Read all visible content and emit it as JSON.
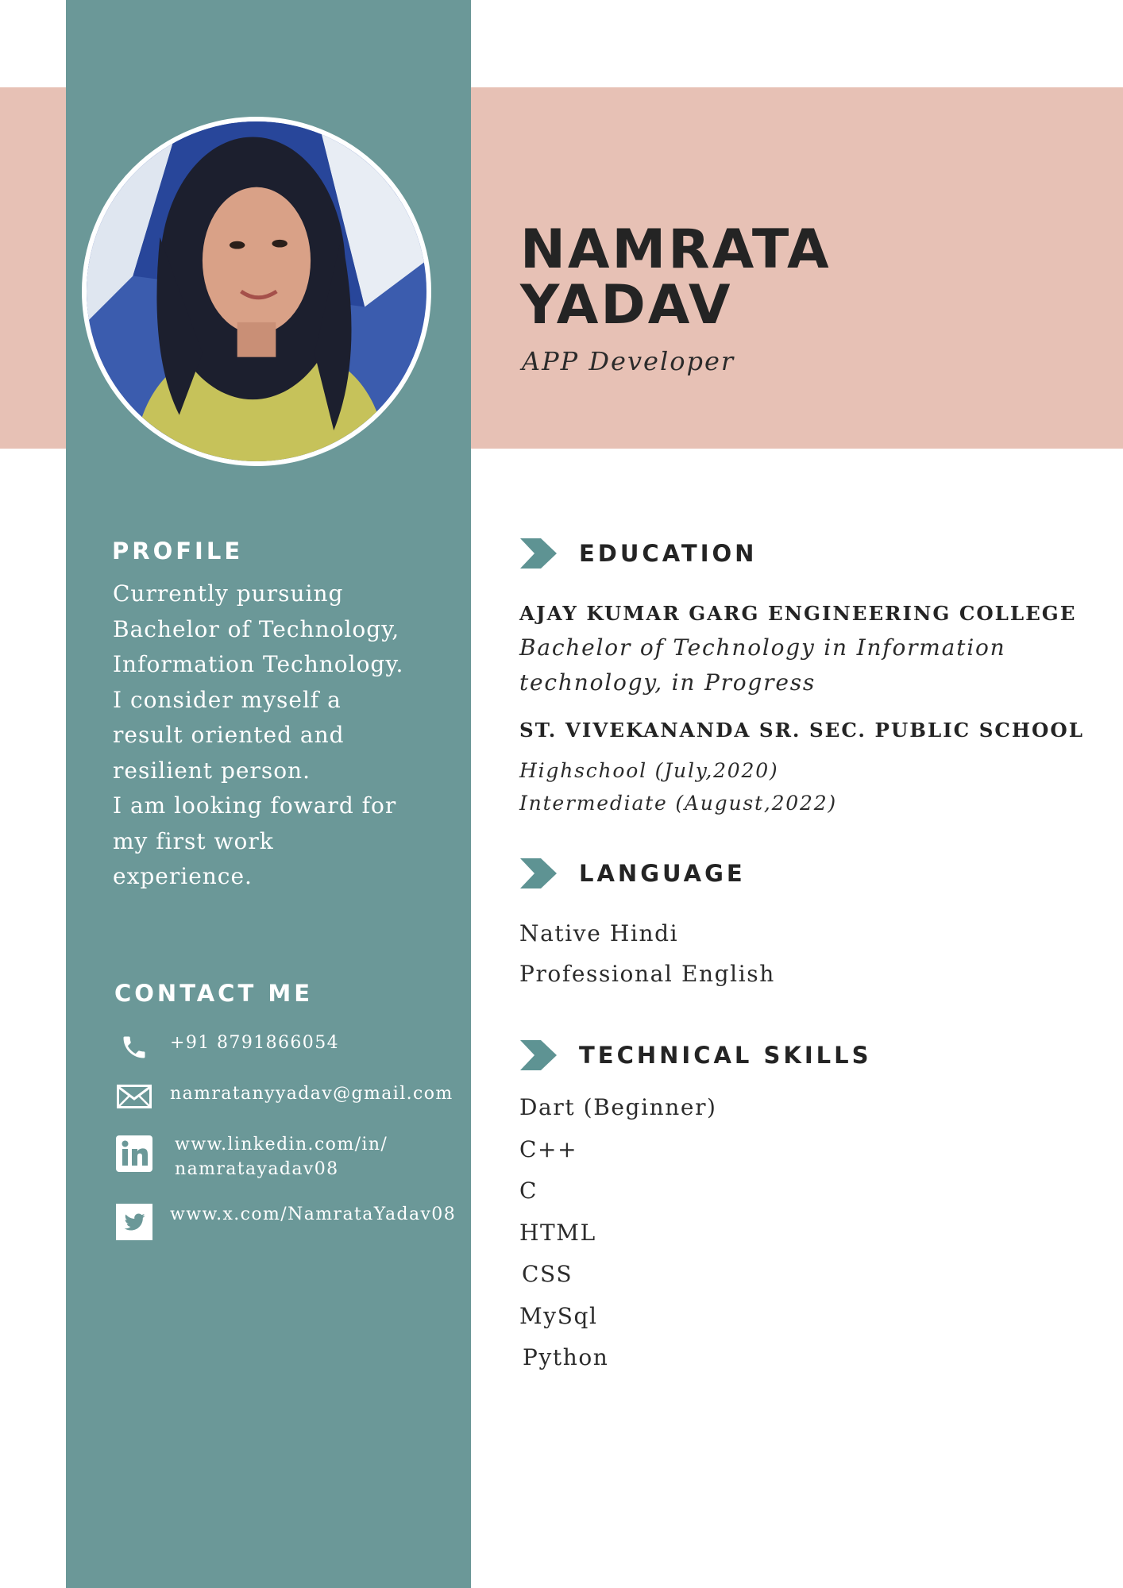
{
  "header": {
    "name_line1": "NAMRATA",
    "name_line2": "YADAV",
    "role": "APP Developer"
  },
  "profile": {
    "heading": "PROFILE",
    "lines": [
      "Currently pursuing",
      "Bachelor of Technology,",
      "Information Technology.",
      "I consider myself a",
      "result oriented and",
      "resilient person.",
      "I am looking foward for",
      "my first work",
      "experience."
    ]
  },
  "contact": {
    "heading": "CONTACT ME",
    "phone": "+91 8791866054",
    "email": "namratanyyadav@gmail.com",
    "linkedin_line1": "www.linkedin.com/in/",
    "linkedin_line2": "namratayadav08",
    "twitter": "www.x.com/NamrataYadav08",
    "icons": [
      "phone-icon",
      "mail-icon",
      "linkedin-icon",
      "twitter-icon"
    ]
  },
  "education": {
    "heading": "EDUCATION",
    "schools": [
      {
        "name": "AJAY KUMAR GARG ENGINEERING COLLEGE",
        "details": [
          "Bachelor of Technology in Information",
          "technology, in Progress"
        ]
      },
      {
        "name": "ST. VIVEKANANDA SR. SEC. PUBLIC SCHOOL",
        "details": [
          "Highschool (July,2020)",
          "Intermediate (August,2022)"
        ]
      }
    ]
  },
  "language": {
    "heading": "LANGUAGE",
    "items": [
      "Native Hindi",
      "Professional English"
    ]
  },
  "skills": {
    "heading": "TECHNICAL SKILLS",
    "items": [
      "Dart (Beginner)",
      "C++",
      "C",
      "HTML",
      "CSS",
      "MySql",
      "Python"
    ]
  },
  "colors": {
    "sidebar": "#6b9898",
    "band": "#e7c1b5",
    "text_dark": "#242424",
    "text_light": "#ffffff"
  }
}
